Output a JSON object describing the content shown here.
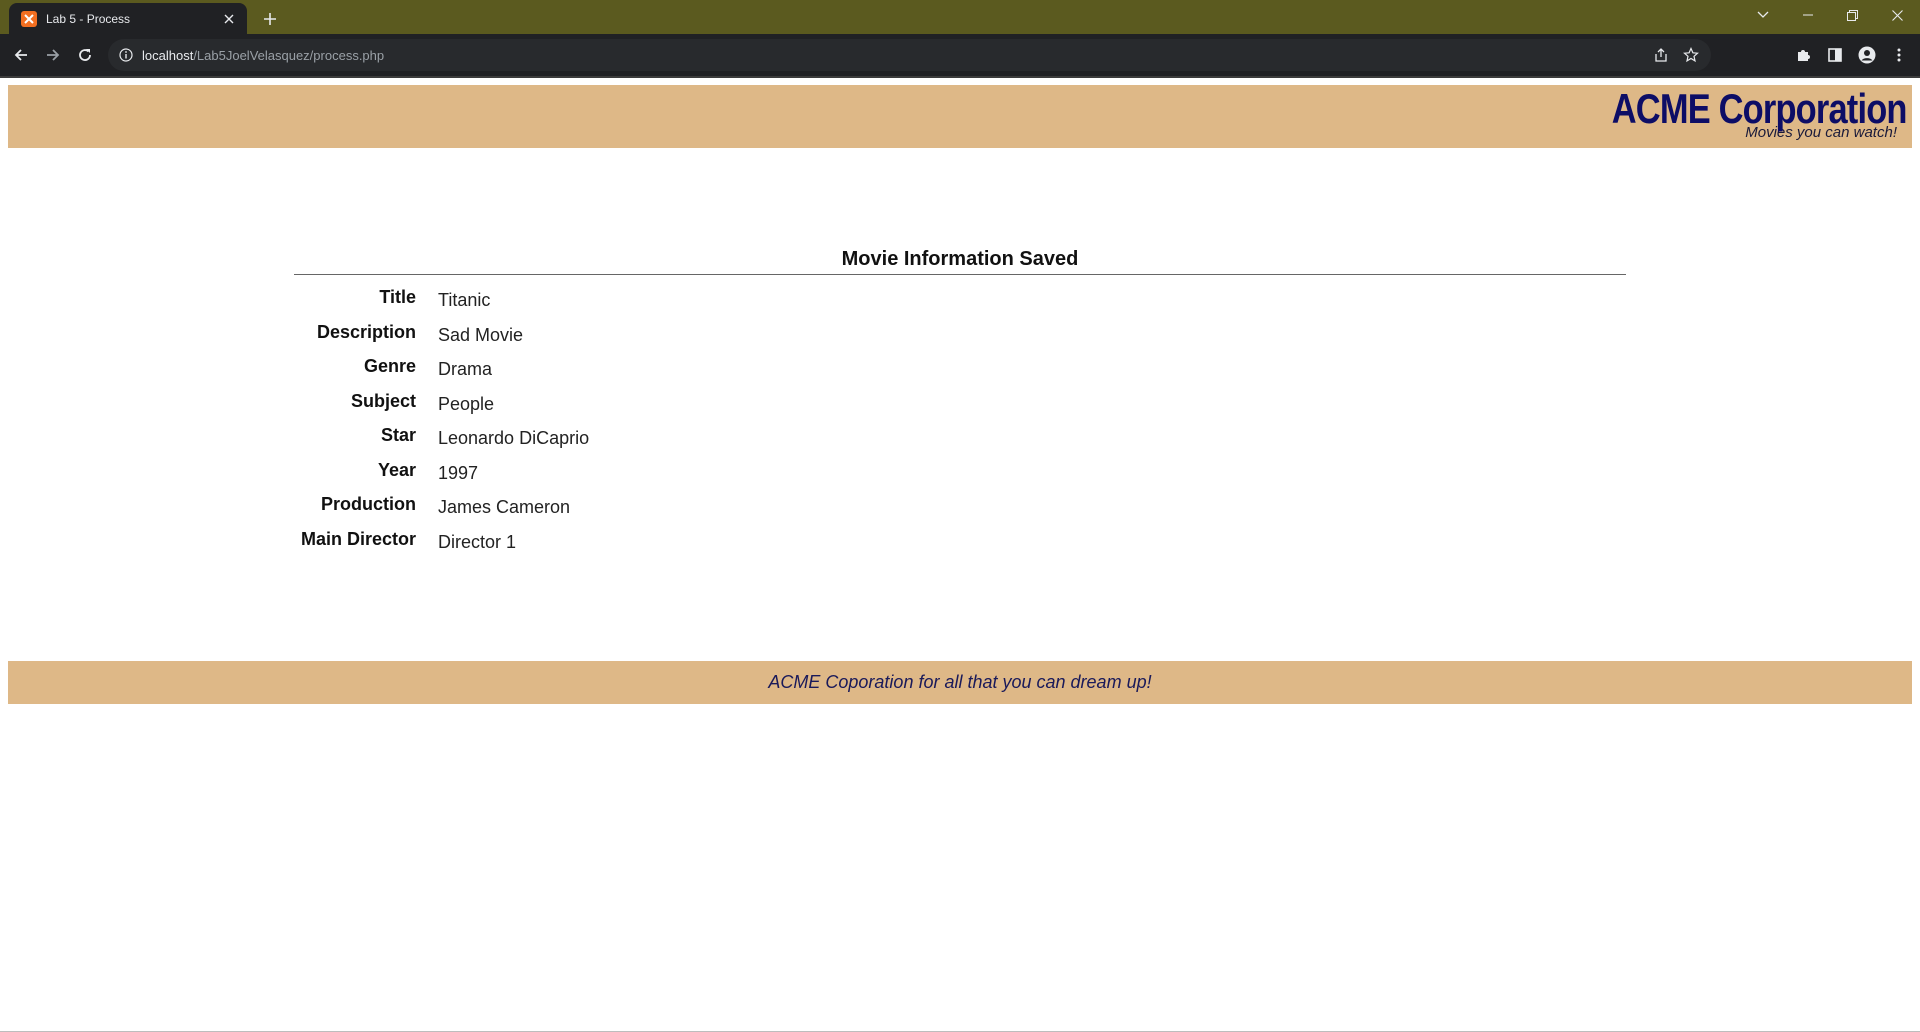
{
  "browser": {
    "tab_title": "Lab 5 - Process",
    "url_host": "localhost",
    "url_path": "/Lab5JoelVelasquez/process.php"
  },
  "site": {
    "brand_name": "ACME Corporation",
    "tagline": "Movies you can watch!",
    "footer_text": "ACME Coporation for all that you can dream up!",
    "accent_color": "#deb887",
    "brand_color": "#0d0d66"
  },
  "content": {
    "heading": "Movie Information Saved",
    "fields": [
      {
        "label": "Title",
        "value": "Titanic"
      },
      {
        "label": "Description",
        "value": "Sad Movie"
      },
      {
        "label": "Genre",
        "value": "Drama"
      },
      {
        "label": "Subject",
        "value": "People"
      },
      {
        "label": "Star",
        "value": "Leonardo DiCaprio"
      },
      {
        "label": "Year",
        "value": "1997"
      },
      {
        "label": "Production",
        "value": "James Cameron"
      },
      {
        "label": "Main Director",
        "value": "Director 1"
      }
    ]
  }
}
